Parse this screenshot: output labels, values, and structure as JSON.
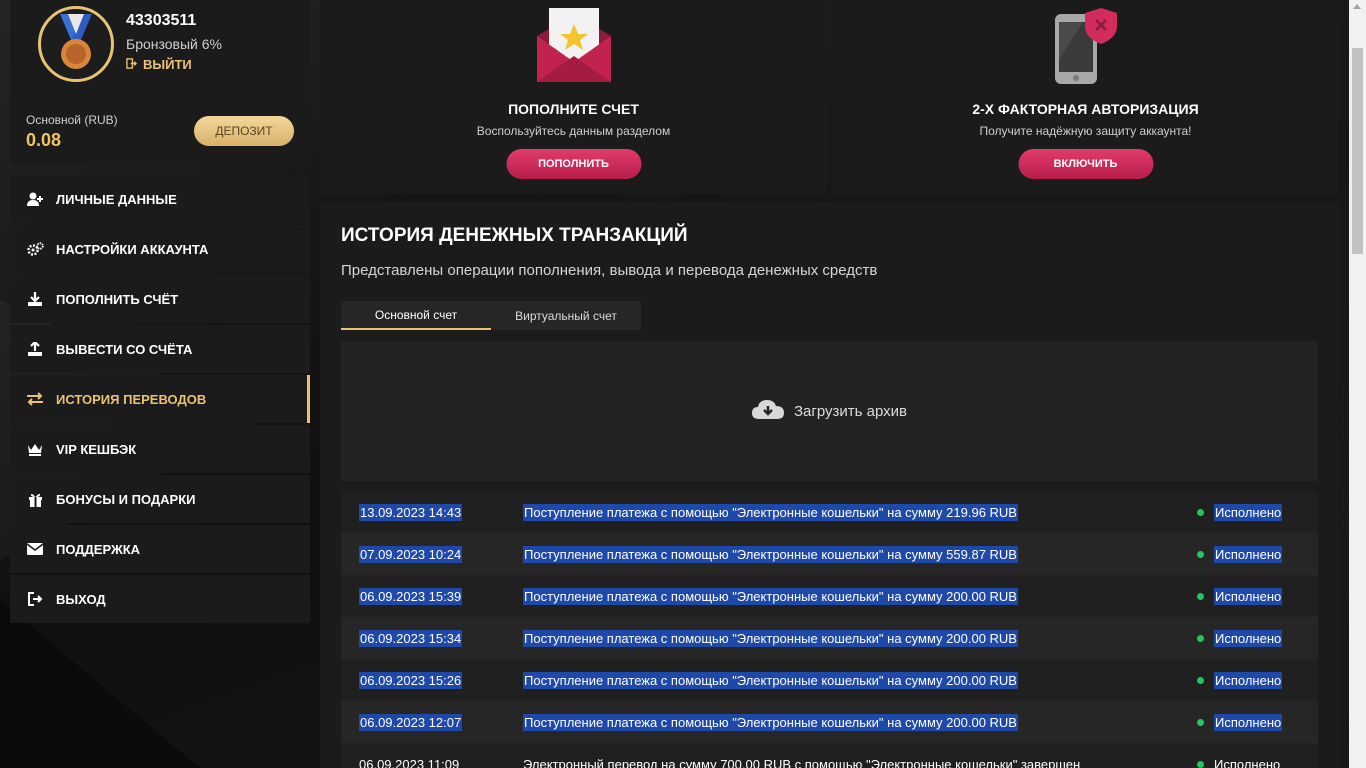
{
  "profile": {
    "user_id": "43303511",
    "level": "Бронзовый 6%",
    "logout_label": "ВЫЙТИ",
    "balance_label": "Основной (RUB)",
    "balance_value": "0.08",
    "deposit_label": "ДЕПОЗИТ"
  },
  "menu": {
    "items": [
      {
        "label": "ЛИЧНЫЕ ДАННЫЕ",
        "icon": "user-plus-icon"
      },
      {
        "label": "НАСТРОЙКИ АККАУНТА",
        "icon": "gears-icon"
      },
      {
        "label": "ПОПОЛНИТЬ СЧЁТ",
        "icon": "download-icon"
      },
      {
        "label": "ВЫВЕСТИ СО СЧЁТА",
        "icon": "upload-icon"
      },
      {
        "label": "ИСТОРИЯ ПЕРЕВОДОВ",
        "icon": "exchange-icon",
        "active": true
      },
      {
        "label": "VIP КЕШБЭК",
        "icon": "crown-icon"
      },
      {
        "label": "БОНУСЫ И ПОДАРКИ",
        "icon": "gift-icon"
      },
      {
        "label": "ПОДДЕРЖКА",
        "icon": "envelope-icon"
      },
      {
        "label": "ВЫХОД",
        "icon": "sign-out-icon"
      }
    ]
  },
  "cards": {
    "deposit": {
      "title": "ПОПОЛНИТЕ СЧЕТ",
      "subtitle": "Воспользуйтесь данным разделом",
      "button": "ПОПОЛНИТЬ"
    },
    "twofa": {
      "title": "2-Х ФАКТОРНАЯ АВТОРИЗАЦИЯ",
      "subtitle": "Получите надёжную защиту аккаунта!",
      "button": "ВКЛЮЧИТЬ"
    }
  },
  "history": {
    "title": "ИСТОРИЯ ДЕНЕЖНЫХ ТРАНЗАКЦИЙ",
    "subtitle": "Представлены операции пополнения, вывода и перевода денежных средств",
    "tabs": [
      "Основной счет",
      "Виртуальный счет"
    ],
    "archive_label": "Загрузить архив",
    "transactions": [
      {
        "date": "13.09.2023 14:43",
        "desc": "Поступление платежа с помощью \"Электронные кошельки\" на сумму 219.96 RUB",
        "status": "Исполнено"
      },
      {
        "date": "07.09.2023 10:24",
        "desc": "Поступление платежа с помощью \"Электронные кошельки\" на сумму 559.87 RUB",
        "status": "Исполнено"
      },
      {
        "date": "06.09.2023 15:39",
        "desc": "Поступление платежа с помощью \"Электронные кошельки\" на сумму 200.00 RUB",
        "status": "Исполнено"
      },
      {
        "date": "06.09.2023 15:34",
        "desc": "Поступление платежа с помощью \"Электронные кошельки\" на сумму 200.00 RUB",
        "status": "Исполнено"
      },
      {
        "date": "06.09.2023 15:26",
        "desc": "Поступление платежа с помощью \"Электронные кошельки\" на сумму 200.00 RUB",
        "status": "Исполнено"
      },
      {
        "date": "06.09.2023 12:07",
        "desc": "Поступление платежа с помощью \"Электронные кошельки\" на сумму 200.00 RUB",
        "status": "Исполнено"
      },
      {
        "date": "06.09.2023 11:09",
        "desc": "Электронный перевод на сумму 700.00 RUB с помощью \"Электронные кошельки\" завершен",
        "status": "Исполнено"
      }
    ]
  },
  "colors": {
    "accent_gold": "#e9c373",
    "button_pink": "#d12c5b",
    "status_green": "#22c55e",
    "selection_blue": "#1f49a8"
  }
}
